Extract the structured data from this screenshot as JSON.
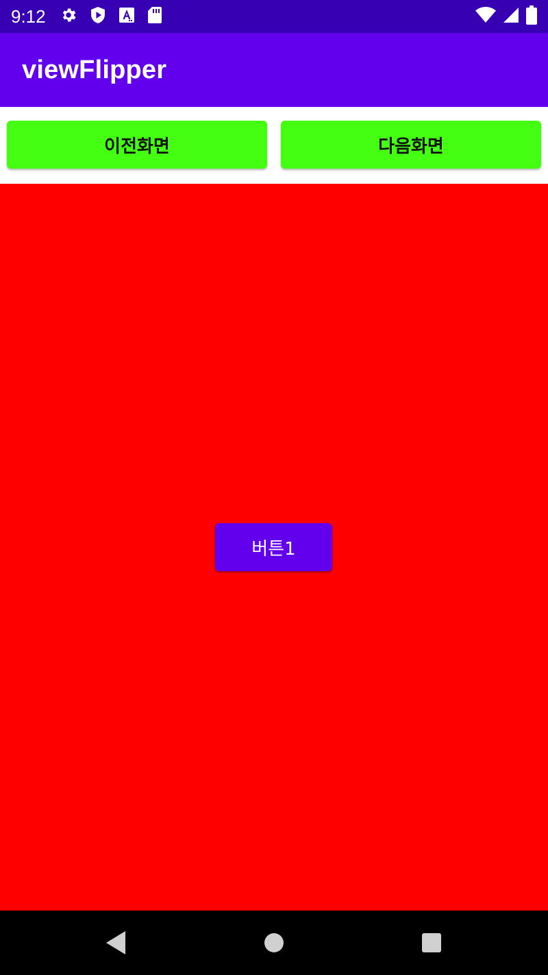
{
  "status_bar": {
    "time": "9:12",
    "left_icons": [
      "settings-icon",
      "shield-play-icon",
      "text-a-icon",
      "sd-card-icon"
    ],
    "right_icons": [
      "wifi-icon",
      "cellular-signal-icon",
      "battery-icon"
    ]
  },
  "app_bar": {
    "title": "viewFlipper",
    "color": "#6200ee"
  },
  "nav_buttons": {
    "prev_label": "이전화면",
    "next_label": "다음화면",
    "color": "#44ff11"
  },
  "flipper": {
    "background": "#ff0000",
    "button_label": "버튼1",
    "button_color": "#6200ee"
  },
  "system_nav": {
    "keys": [
      "back-icon",
      "home-icon",
      "recents-icon"
    ]
  }
}
